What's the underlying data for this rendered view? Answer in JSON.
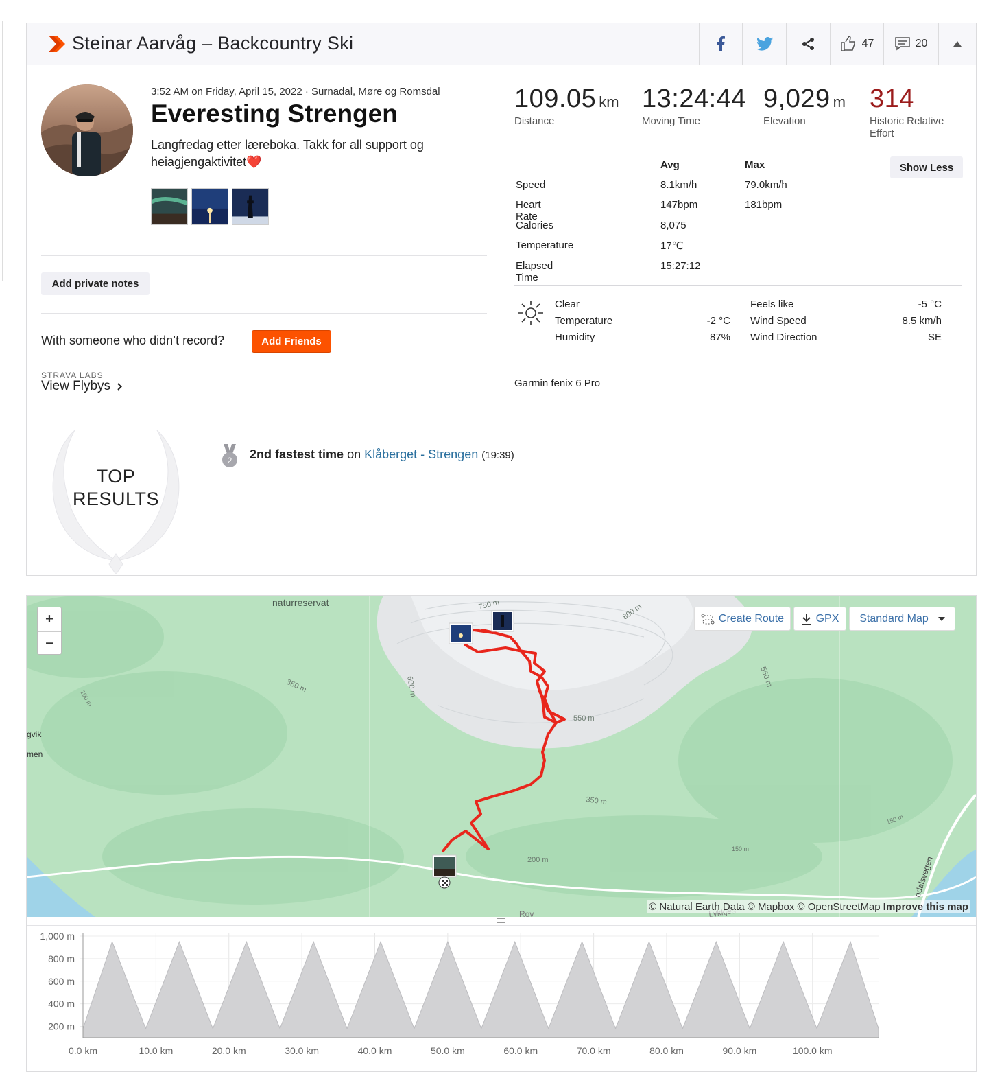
{
  "header": {
    "title": "Steinar Aarvåg – Backcountry Ski",
    "kudos_count": "47",
    "comment_count": "20",
    "icons": [
      "strava-logo-icon",
      "facebook-icon",
      "twitter-icon",
      "share-icon",
      "kudos-thumb-icon",
      "comment-icon",
      "collapse-caret-icon"
    ]
  },
  "activity": {
    "meta": "3:52 AM on Friday, April 15, 2022 · Surnadal, Møre og Romsdal",
    "name": "Everesting Strengen",
    "description": "Langfredag etter læreboka. Takk for all support og heiagjengaktivitet",
    "description_emoji": "❤️",
    "add_notes": "Add private notes",
    "with_someone": "With someone who didn’t record?",
    "add_friends": "Add Friends",
    "labs_label": "STRAVA LABS",
    "flybys": "View Flybys"
  },
  "stats": {
    "distance": {
      "value": "109.05",
      "unit": "km",
      "label": "Distance"
    },
    "moving_time": {
      "value": "13:24:44",
      "label": "Moving Time"
    },
    "elevation": {
      "value": "9,029",
      "unit": "m",
      "label": "Elevation"
    },
    "relative_effort": {
      "value": "314",
      "label": "Historic Relative Effort",
      "color": "#9b1c1c"
    }
  },
  "details": {
    "col_avg": "Avg",
    "col_max": "Max",
    "toggle": "Show Less",
    "rows": [
      {
        "label": "Speed",
        "avg": "8.1km/h",
        "max": "79.0km/h"
      },
      {
        "label": "Heart Rate",
        "avg": "147bpm",
        "max": "181bpm"
      },
      {
        "label": "Calories",
        "avg": "8,075",
        "max": ""
      },
      {
        "label": "Temperature",
        "avg": "17℃",
        "max": ""
      },
      {
        "label": "Elapsed Time",
        "avg": "15:27:12",
        "max": ""
      }
    ]
  },
  "weather": {
    "condition": "Clear",
    "temperature_label": "Temperature",
    "temperature": "-2 °C",
    "humidity_label": "Humidity",
    "humidity": "87%",
    "feels_like_label": "Feels like",
    "feels_like": "-5 °C",
    "wind_speed_label": "Wind Speed",
    "wind_speed": "8.5 km/h",
    "wind_direction_label": "Wind Direction",
    "wind_direction": "SE"
  },
  "device": "Garmin fēnix 6 Pro",
  "top_results": {
    "title_line1": "TOP",
    "title_line2": "RESULTS",
    "medal_rank": "2",
    "achievement_bold": "2nd fastest time",
    "achievement_on": "on",
    "segment": "Klåberget - Strengen",
    "segment_time": "(19:39)"
  },
  "map": {
    "zoom_in": "+",
    "zoom_out": "−",
    "create_route": "Create Route",
    "gpx": "GPX",
    "map_style": "Standard Map",
    "attribution": "© Natural Earth Data © Mapbox © OpenStreetMap",
    "improve": "Improve this map",
    "labels": [
      "naturreservat",
      "750 m",
      "800 m",
      "550 m",
      "550 m",
      "600 m",
      "350 m",
      "350 m",
      "200 m",
      "150 m",
      "150 m",
      "100 m",
      "gvik",
      "men",
      "odalsvegen",
      "Lykkjes",
      "Rov"
    ],
    "route_color": "#e8261c"
  },
  "chart_data": {
    "type": "area",
    "title": "",
    "xlabel": "",
    "ylabel": "",
    "x_unit": "km",
    "xlim": [
      0,
      109.05
    ],
    "ylim": [
      100,
      1000
    ],
    "y_ticks": [
      "1,000 m",
      "800 m",
      "600 m",
      "400 m",
      "200 m"
    ],
    "y_tick_values": [
      1000,
      800,
      600,
      400,
      200
    ],
    "x_ticks": [
      "0.0 km",
      "10.0 km",
      "20.0 km",
      "30.0 km",
      "40.0 km",
      "50.0 km",
      "60.0 km",
      "70.0 km",
      "80.0 km",
      "90.0 km",
      "100.0 km"
    ],
    "x_tick_values": [
      0,
      10,
      20,
      30,
      40,
      50,
      60,
      70,
      80,
      90,
      100
    ],
    "series": [
      {
        "x": [
          0,
          4,
          8.6,
          13.2,
          17.8,
          22.4,
          27.0,
          31.6,
          36.2,
          40.8,
          45.4,
          50.0,
          54.6,
          59.2,
          63.8,
          68.4,
          73.0,
          77.6,
          82.2,
          86.8,
          91.4,
          96.0,
          100.6,
          105.2,
          109.05
        ],
        "values": [
          180,
          950,
          180,
          950,
          180,
          950,
          180,
          950,
          180,
          950,
          180,
          950,
          180,
          950,
          180,
          950,
          180,
          950,
          180,
          950,
          180,
          950,
          180,
          950,
          180
        ]
      }
    ]
  }
}
